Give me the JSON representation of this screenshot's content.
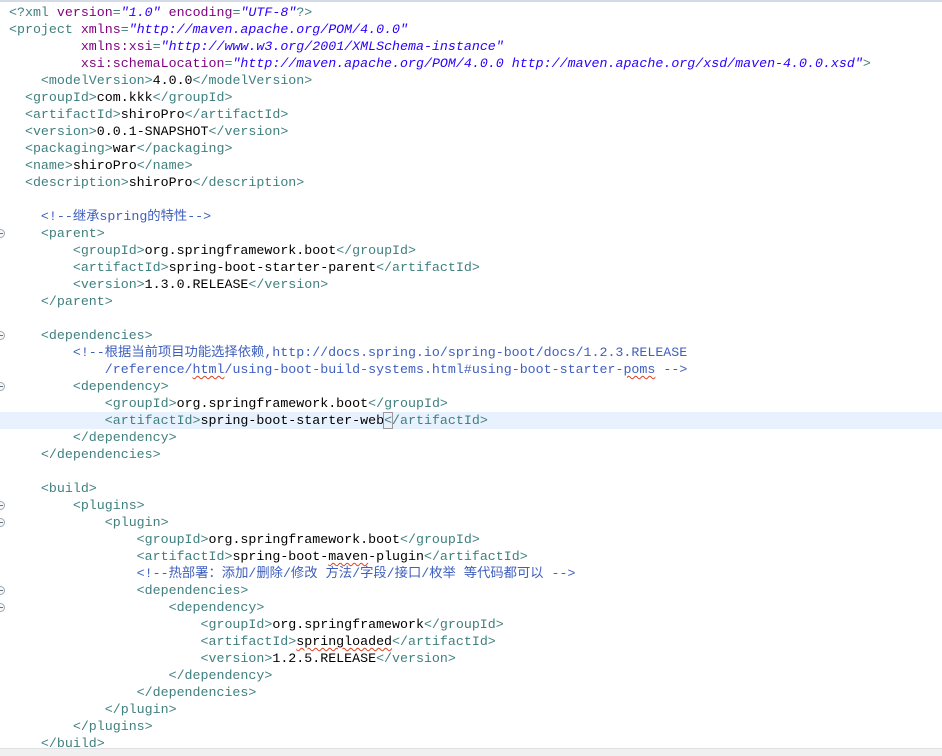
{
  "editor": {
    "lines": [
      {
        "indent": 0,
        "tokens": [
          [
            "t",
            "<?xml "
          ],
          [
            "a",
            "version"
          ],
          [
            "t",
            "="
          ],
          [
            "v",
            "\"1.0\""
          ],
          [
            "t",
            " "
          ],
          [
            "a",
            "encoding"
          ],
          [
            "t",
            "="
          ],
          [
            "v",
            "\"UTF-8\""
          ],
          [
            "t",
            "?>"
          ]
        ]
      },
      {
        "indent": 0,
        "tokens": [
          [
            "t",
            "<project "
          ],
          [
            "a",
            "xmlns"
          ],
          [
            "t",
            "="
          ],
          [
            "v",
            "\"http://maven.apache.org/POM/4.0.0\""
          ]
        ]
      },
      {
        "indent": 9,
        "tokens": [
          [
            "a",
            "xmlns:xsi"
          ],
          [
            "t",
            "="
          ],
          [
            "v",
            "\"http://www.w3.org/2001/XMLSchema-instance\""
          ]
        ]
      },
      {
        "indent": 9,
        "tokens": [
          [
            "a",
            "xsi:schemaLocation"
          ],
          [
            "t",
            "="
          ],
          [
            "v",
            "\"http://maven.apache.org/POM/4.0.0 http://maven.apache.org/xsd/maven-4.0.0.xsd\""
          ],
          [
            "t",
            ">"
          ]
        ]
      },
      {
        "indent": 4,
        "tokens": [
          [
            "t",
            "<modelVersion>"
          ],
          [
            "x",
            "4.0.0"
          ],
          [
            "t",
            "</modelVersion>"
          ]
        ]
      },
      {
        "indent": 2,
        "tokens": [
          [
            "t",
            "<groupId>"
          ],
          [
            "x",
            "com.kkk"
          ],
          [
            "t",
            "</groupId>"
          ]
        ]
      },
      {
        "indent": 2,
        "tokens": [
          [
            "t",
            "<artifactId>"
          ],
          [
            "x",
            "shiroPro"
          ],
          [
            "t",
            "</artifactId>"
          ]
        ]
      },
      {
        "indent": 2,
        "tokens": [
          [
            "t",
            "<version>"
          ],
          [
            "x",
            "0.0.1-SNAPSHOT"
          ],
          [
            "t",
            "</version>"
          ]
        ]
      },
      {
        "indent": 2,
        "tokens": [
          [
            "t",
            "<packaging>"
          ],
          [
            "x",
            "war"
          ],
          [
            "t",
            "</packaging>"
          ]
        ]
      },
      {
        "indent": 2,
        "tokens": [
          [
            "t",
            "<name>"
          ],
          [
            "x",
            "shiroPro"
          ],
          [
            "t",
            "</name>"
          ]
        ]
      },
      {
        "indent": 2,
        "tokens": [
          [
            "t",
            "<description>"
          ],
          [
            "x",
            "shiroPro"
          ],
          [
            "t",
            "</description>"
          ]
        ]
      },
      {
        "indent": 0,
        "tokens": []
      },
      {
        "indent": 4,
        "tokens": [
          [
            "c",
            "<!--继承spring的特性-->"
          ]
        ]
      },
      {
        "indent": 4,
        "fold": true,
        "tokens": [
          [
            "t",
            "<parent>"
          ]
        ]
      },
      {
        "indent": 8,
        "tokens": [
          [
            "t",
            "<groupId>"
          ],
          [
            "x",
            "org.springframework.boot"
          ],
          [
            "t",
            "</groupId>"
          ]
        ]
      },
      {
        "indent": 8,
        "tokens": [
          [
            "t",
            "<artifactId>"
          ],
          [
            "x",
            "spring-boot-starter-parent"
          ],
          [
            "t",
            "</artifactId>"
          ]
        ]
      },
      {
        "indent": 8,
        "tokens": [
          [
            "t",
            "<version>"
          ],
          [
            "x",
            "1.3.0.RELEASE"
          ],
          [
            "t",
            "</version>"
          ]
        ]
      },
      {
        "indent": 4,
        "tokens": [
          [
            "t",
            "</parent>"
          ]
        ]
      },
      {
        "indent": 0,
        "tokens": []
      },
      {
        "indent": 4,
        "fold": true,
        "tokens": [
          [
            "t",
            "<dependencies>"
          ]
        ]
      },
      {
        "indent": 8,
        "tokens": [
          [
            "c",
            "<!--根据当前项目功能选择依赖,http://docs.spring.io/spring-boot/docs/1.2.3.RELEASE"
          ]
        ]
      },
      {
        "indent": 12,
        "tokens": [
          [
            "c",
            "/reference/"
          ],
          [
            "c~",
            "html"
          ],
          [
            "c",
            "/using-boot-build-systems.html#using-boot-starter-"
          ],
          [
            "c~",
            "poms"
          ],
          [
            "c",
            " -->"
          ]
        ]
      },
      {
        "indent": 8,
        "fold": true,
        "tokens": [
          [
            "t",
            "<dependency>"
          ]
        ]
      },
      {
        "indent": 12,
        "tokens": [
          [
            "t",
            "<groupId>"
          ],
          [
            "x",
            "org.springframework.boot"
          ],
          [
            "t",
            "</groupId>"
          ]
        ]
      },
      {
        "indent": 12,
        "highlight": true,
        "tokens": [
          [
            "t",
            "<artifactId>"
          ],
          [
            "x",
            "spring-boot-starter-web"
          ],
          [
            "t^",
            "<"
          ],
          [
            "t",
            "/artifactId>"
          ]
        ]
      },
      {
        "indent": 8,
        "tokens": [
          [
            "t",
            "</dependency>"
          ]
        ]
      },
      {
        "indent": 4,
        "tokens": [
          [
            "t",
            "</dependencies>"
          ]
        ]
      },
      {
        "indent": 0,
        "tokens": []
      },
      {
        "indent": 4,
        "tokens": [
          [
            "t",
            "<build>"
          ]
        ]
      },
      {
        "indent": 8,
        "fold": true,
        "tokens": [
          [
            "t",
            "<plugins>"
          ]
        ]
      },
      {
        "indent": 12,
        "fold": true,
        "tokens": [
          [
            "t",
            "<plugin>"
          ]
        ]
      },
      {
        "indent": 16,
        "tokens": [
          [
            "t",
            "<groupId>"
          ],
          [
            "x",
            "org.springframework.boot"
          ],
          [
            "t",
            "</groupId>"
          ]
        ]
      },
      {
        "indent": 16,
        "tokens": [
          [
            "t",
            "<artifactId>"
          ],
          [
            "x",
            "spring-boot-"
          ],
          [
            "x~",
            "maven"
          ],
          [
            "x",
            "-plugin"
          ],
          [
            "t",
            "</artifactId>"
          ]
        ]
      },
      {
        "indent": 16,
        "tokens": [
          [
            "c",
            "<!--热部署：添加/删除/修改 方法/字段/接口/枚举 等代码都可以 -->"
          ]
        ]
      },
      {
        "indent": 16,
        "fold": true,
        "tokens": [
          [
            "t",
            "<dependencies>"
          ]
        ]
      },
      {
        "indent": 20,
        "fold": true,
        "tokens": [
          [
            "t",
            "<dependency>"
          ]
        ]
      },
      {
        "indent": 24,
        "tokens": [
          [
            "t",
            "<groupId>"
          ],
          [
            "x",
            "org.springframework"
          ],
          [
            "t",
            "</groupId>"
          ]
        ]
      },
      {
        "indent": 24,
        "tokens": [
          [
            "t",
            "<artifactId>"
          ],
          [
            "x~",
            "springloaded"
          ],
          [
            "t",
            "</artifactId>"
          ]
        ]
      },
      {
        "indent": 24,
        "tokens": [
          [
            "t",
            "<version>"
          ],
          [
            "x",
            "1.2.5.RELEASE"
          ],
          [
            "t",
            "</version>"
          ]
        ]
      },
      {
        "indent": 20,
        "tokens": [
          [
            "t",
            "</dependency>"
          ]
        ]
      },
      {
        "indent": 16,
        "tokens": [
          [
            "t",
            "</dependencies>"
          ]
        ]
      },
      {
        "indent": 12,
        "tokens": [
          [
            "t",
            "</plugin>"
          ]
        ]
      },
      {
        "indent": 8,
        "tokens": [
          [
            "t",
            "</plugins>"
          ]
        ]
      },
      {
        "indent": 4,
        "tokens": [
          [
            "t",
            "</build>"
          ]
        ]
      }
    ]
  },
  "colors": {
    "tag": "#3f7f7f",
    "attr": "#7f007f",
    "value": "#2a00ff",
    "comment": "#3f5fbf",
    "current_line": "#e8f2fe"
  }
}
